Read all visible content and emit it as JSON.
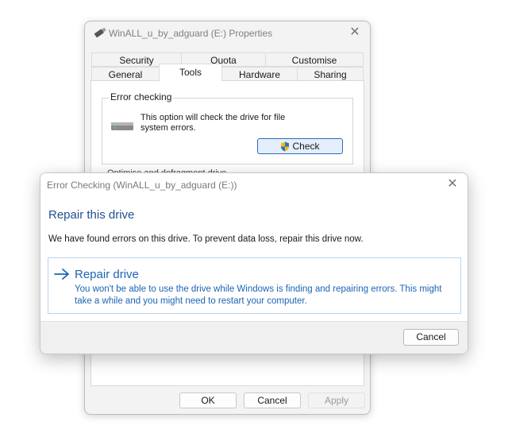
{
  "properties_window": {
    "title": "WinALL_u_by_adguard (E:) Properties",
    "close_glyph": "✕",
    "tabs_row1": [
      {
        "label": "Security"
      },
      {
        "label": "Quota"
      },
      {
        "label": "Customise"
      }
    ],
    "tabs_row2": [
      {
        "label": "General"
      },
      {
        "label": "Tools"
      },
      {
        "label": "Hardware"
      },
      {
        "label": "Sharing"
      }
    ],
    "active_tab": "Tools",
    "error_checking": {
      "group_label": "Error checking",
      "description": "This option will check the drive for file system errors.",
      "check_button": "Check"
    },
    "cut_text": "Optimise and defragment drive",
    "buttons": {
      "ok": "OK",
      "cancel": "Cancel",
      "apply": "Apply"
    }
  },
  "error_dialog": {
    "title": "Error Checking (WinALL_u_by_adguard (E:))",
    "close_glyph": "✕",
    "heading": "Repair this drive",
    "message": "We have found errors on this drive. To prevent data loss, repair this drive now.",
    "option": {
      "title": "Repair drive",
      "description": "You won't be able to use the drive while Windows is finding and repairing errors. This might take a while and you might need to restart your computer."
    },
    "cancel_button": "Cancel"
  },
  "icons": {
    "title_icon": "usb-drive-icon",
    "drive_icon": "hard-drive-icon",
    "check_icon": "uac-shield-icon",
    "option_icon": "arrow-right-icon"
  },
  "colors": {
    "accent": "#1c64b5",
    "heading": "#1f4f8f",
    "check_button_border": "#2a6bbf"
  }
}
